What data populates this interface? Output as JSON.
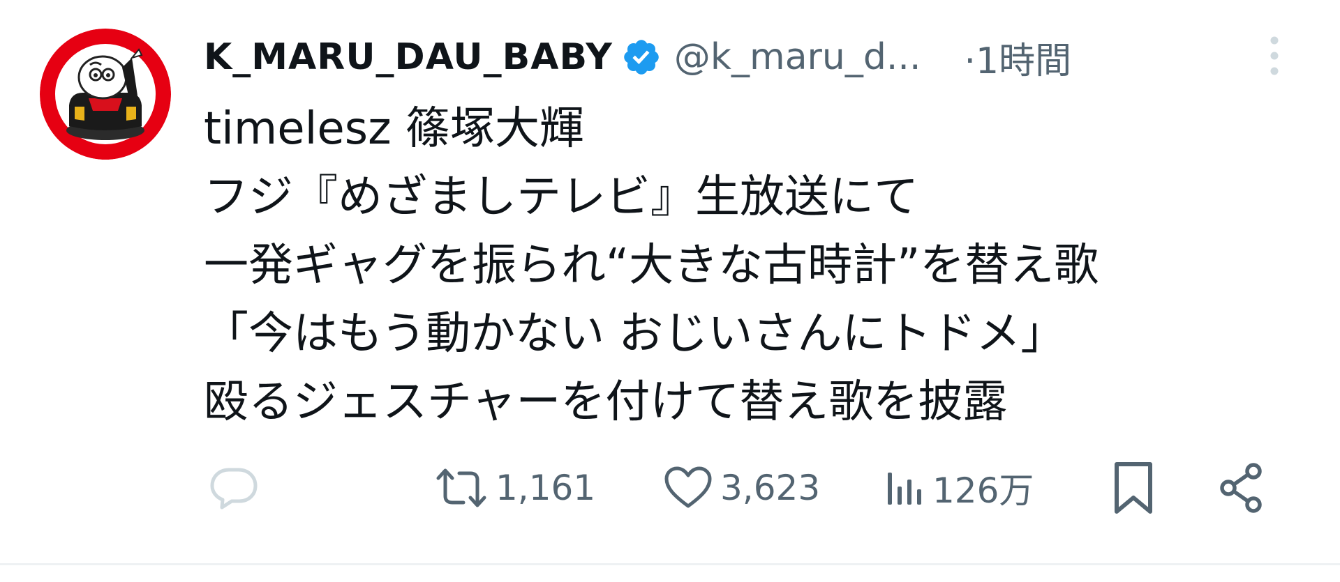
{
  "tweet": {
    "display_name": "K_MARU_DAU_BABY",
    "handle": "@k_maru_d...",
    "time": "·1時間",
    "lines": [
      "timelesz 篠塚大輝",
      "フジ『めざましテレビ』生放送にて",
      "一発ギャグを振られ“大きな古時計”を替え歌",
      "「今はもう動かない おじいさんにトドメ」",
      "殴るジェスチャーを付けて替え歌を披露"
    ]
  },
  "actions": {
    "reply": {
      "icon": "reply-icon"
    },
    "retweet": {
      "icon": "retweet-icon",
      "count": "1,161"
    },
    "like": {
      "icon": "heart-icon",
      "count": "3,623"
    },
    "views": {
      "icon": "views-icon",
      "count": "126万"
    },
    "bookmark": {
      "icon": "bookmark-icon"
    },
    "share": {
      "icon": "share-icon"
    }
  },
  "colors": {
    "text_primary": "#0f1419",
    "text_secondary": "#536471",
    "reply_icon": "#cfd9de",
    "verified": "#1d9bf0",
    "avatar_red": "#e60012",
    "divider": "#eef1f3"
  }
}
